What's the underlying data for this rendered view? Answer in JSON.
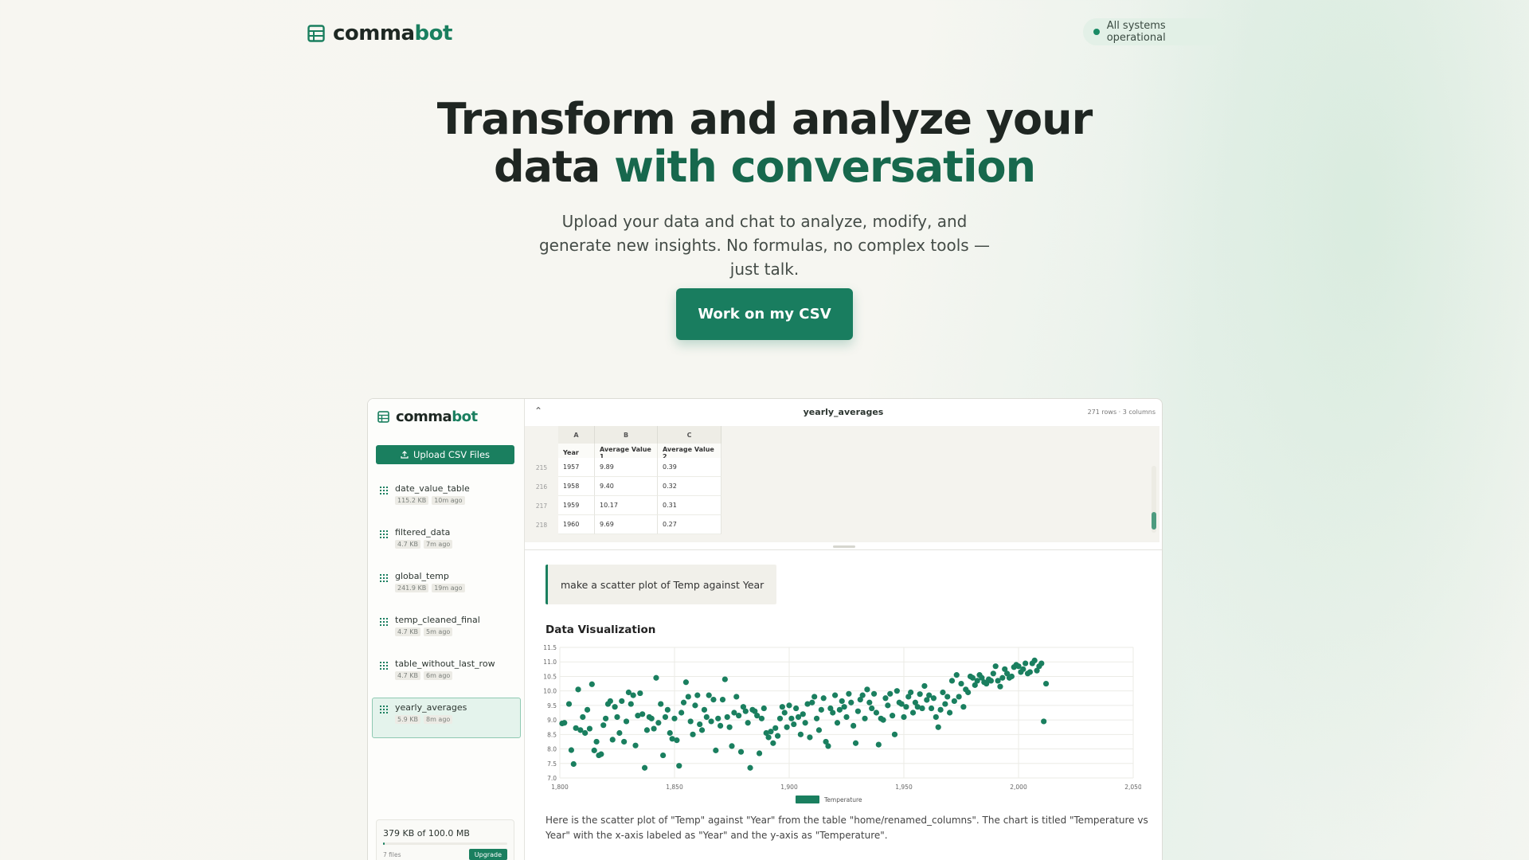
{
  "brand": {
    "name_part1": "comma",
    "name_part2": "bot"
  },
  "status": {
    "text": "All systems operational",
    "color": "#1a8a65"
  },
  "hero": {
    "title_line1": "Transform and analyze your",
    "title_line2_plain": "data ",
    "title_line2_accent": "with conversation",
    "subtitle": "Upload your data and chat to analyze, modify, and generate new insights. No formulas, no complex tools — just talk.",
    "cta_label": "Work on my CSV"
  },
  "sidebar": {
    "upload_label": "Upload CSV Files",
    "files": [
      {
        "name": "date_value_table",
        "size": "115.2 KB",
        "age": "10m ago",
        "active": false
      },
      {
        "name": "filtered_data",
        "size": "4.7 KB",
        "age": "7m ago",
        "active": false
      },
      {
        "name": "global_temp",
        "size": "241.9 KB",
        "age": "19m ago",
        "active": false
      },
      {
        "name": "temp_cleaned_final",
        "size": "4.7 KB",
        "age": "5m ago",
        "active": false
      },
      {
        "name": "table_without_last_row",
        "size": "4.7 KB",
        "age": "6m ago",
        "active": false
      },
      {
        "name": "yearly_averages",
        "size": "5.9 KB",
        "age": "8m ago",
        "active": true
      }
    ],
    "storage": {
      "text": "379 KB of 100.0 MB",
      "used_fraction": 0.0037,
      "files": "7 files",
      "upgrade_label": "Upgrade"
    }
  },
  "table": {
    "collapse_icon": "chevron-up-icon",
    "title": "yearly_averages",
    "meta": "271 rows · 3 columns",
    "column_letters": [
      "A",
      "B",
      "C"
    ],
    "headers": [
      "Year",
      "Average Value 1",
      "Average Value 2"
    ],
    "rows": [
      {
        "num": "215",
        "cells": [
          "1957",
          "9.89",
          "0.39"
        ]
      },
      {
        "num": "216",
        "cells": [
          "1958",
          "9.40",
          "0.32"
        ]
      },
      {
        "num": "217",
        "cells": [
          "1959",
          "10.17",
          "0.31"
        ]
      },
      {
        "num": "218",
        "cells": [
          "1960",
          "9.69",
          "0.27"
        ]
      }
    ]
  },
  "chat": {
    "user_message": "make a scatter plot of Temp against Year",
    "viz_title": "Data Visualization",
    "answer": "Here is the scatter plot of \"Temp\" against \"Year\" from the table \"home/renamed_columns\". The chart is titled \"Temperature vs Year\" with the x-axis labeled as \"Year\" and the y-axis as \"Temperature\"."
  },
  "chart_data": {
    "type": "scatter",
    "series": [
      {
        "name": "Temperature",
        "color": "#1a7f5f",
        "points": [
          [
            1801,
            8.88
          ],
          [
            1802,
            8.9
          ],
          [
            1804,
            9.55
          ],
          [
            1805,
            7.96
          ],
          [
            1806,
            7.48
          ],
          [
            1807,
            8.72
          ],
          [
            1808,
            10.05
          ],
          [
            1809,
            8.65
          ],
          [
            1810,
            9.1
          ],
          [
            1811,
            8.55
          ],
          [
            1812,
            9.35
          ],
          [
            1813,
            8.7
          ],
          [
            1814,
            10.23
          ],
          [
            1815,
            7.95
          ],
          [
            1816,
            8.25
          ],
          [
            1817,
            7.78
          ],
          [
            1818,
            7.82
          ],
          [
            1819,
            8.82
          ],
          [
            1820,
            9.05
          ],
          [
            1821,
            9.55
          ],
          [
            1822,
            9.65
          ],
          [
            1823,
            8.32
          ],
          [
            1824,
            9.45
          ],
          [
            1825,
            9.1
          ],
          [
            1826,
            8.55
          ],
          [
            1827,
            9.65
          ],
          [
            1828,
            8.25
          ],
          [
            1829,
            8.95
          ],
          [
            1830,
            9.95
          ],
          [
            1831,
            9.55
          ],
          [
            1832,
            9.85
          ],
          [
            1833,
            8.12
          ],
          [
            1834,
            9.15
          ],
          [
            1835,
            9.92
          ],
          [
            1836,
            9.2
          ],
          [
            1837,
            7.35
          ],
          [
            1838,
            8.65
          ],
          [
            1839,
            9.1
          ],
          [
            1840,
            9.05
          ],
          [
            1841,
            8.7
          ],
          [
            1842,
            10.45
          ],
          [
            1843,
            8.9
          ],
          [
            1844,
            9.55
          ],
          [
            1845,
            7.78
          ],
          [
            1846,
            9.1
          ],
          [
            1847,
            9.35
          ],
          [
            1848,
            8.55
          ],
          [
            1849,
            8.35
          ],
          [
            1850,
            9.05
          ],
          [
            1851,
            8.3
          ],
          [
            1852,
            7.42
          ],
          [
            1853,
            9.25
          ],
          [
            1854,
            9.6
          ],
          [
            1855,
            10.3
          ],
          [
            1856,
            9.8
          ],
          [
            1857,
            8.95
          ],
          [
            1858,
            8.5
          ],
          [
            1859,
            9.5
          ],
          [
            1860,
            9.85
          ],
          [
            1861,
            8.85
          ],
          [
            1862,
            8.65
          ],
          [
            1863,
            9.35
          ],
          [
            1864,
            9.1
          ],
          [
            1865,
            9.85
          ],
          [
            1866,
            8.95
          ],
          [
            1867,
            9.7
          ],
          [
            1868,
            7.95
          ],
          [
            1869,
            9.05
          ],
          [
            1870,
            8.8
          ],
          [
            1871,
            9.7
          ],
          [
            1872,
            10.4
          ],
          [
            1873,
            9.1
          ],
          [
            1874,
            8.75
          ],
          [
            1875,
            8.1
          ],
          [
            1876,
            9.25
          ],
          [
            1877,
            9.8
          ],
          [
            1878,
            9.15
          ],
          [
            1879,
            7.9
          ],
          [
            1880,
            9.45
          ],
          [
            1881,
            9.3
          ],
          [
            1882,
            8.9
          ],
          [
            1883,
            7.35
          ],
          [
            1884,
            9.35
          ],
          [
            1885,
            9.3
          ],
          [
            1886,
            9.15
          ],
          [
            1887,
            7.85
          ],
          [
            1888,
            9.05
          ],
          [
            1889,
            9.4
          ],
          [
            1890,
            8.55
          ],
          [
            1891,
            8.4
          ],
          [
            1892,
            8.6
          ],
          [
            1893,
            8.2
          ],
          [
            1894,
            8.72
          ],
          [
            1895,
            8.45
          ],
          [
            1896,
            9.05
          ],
          [
            1897,
            9.45
          ],
          [
            1898,
            9.25
          ],
          [
            1899,
            8.75
          ],
          [
            1900,
            9.5
          ],
          [
            1901,
            9.05
          ],
          [
            1902,
            8.85
          ],
          [
            1903,
            9.4
          ],
          [
            1904,
            9.1
          ],
          [
            1905,
            8.5
          ],
          [
            1906,
            9.2
          ],
          [
            1907,
            8.9
          ],
          [
            1908,
            9.55
          ],
          [
            1909,
            8.4
          ],
          [
            1910,
            9.6
          ],
          [
            1911,
            9.8
          ],
          [
            1912,
            9.05
          ],
          [
            1913,
            8.65
          ],
          [
            1914,
            9.35
          ],
          [
            1915,
            9.75
          ],
          [
            1916,
            8.25
          ],
          [
            1917,
            8.1
          ],
          [
            1918,
            9.4
          ],
          [
            1919,
            9.25
          ],
          [
            1920,
            9.85
          ],
          [
            1921,
            8.9
          ],
          [
            1922,
            9.35
          ],
          [
            1923,
            9.65
          ],
          [
            1924,
            9.45
          ],
          [
            1925,
            9.1
          ],
          [
            1926,
            9.9
          ],
          [
            1927,
            9.6
          ],
          [
            1928,
            8.8
          ],
          [
            1929,
            8.2
          ],
          [
            1930,
            9.3
          ],
          [
            1931,
            9.7
          ],
          [
            1932,
            9.85
          ],
          [
            1933,
            9.05
          ],
          [
            1934,
            10.05
          ],
          [
            1935,
            9.6
          ],
          [
            1936,
            9.4
          ],
          [
            1937,
            9.9
          ],
          [
            1938,
            9.25
          ],
          [
            1939,
            8.15
          ],
          [
            1940,
            9.05
          ],
          [
            1941,
            9.0
          ],
          [
            1942,
            9.75
          ],
          [
            1943,
            9.5
          ],
          [
            1944,
            9.9
          ],
          [
            1945,
            9.15
          ],
          [
            1946,
            8.5
          ],
          [
            1947,
            10.0
          ],
          [
            1948,
            9.6
          ],
          [
            1949,
            9.55
          ],
          [
            1950,
            9.1
          ],
          [
            1951,
            9.45
          ],
          [
            1952,
            9.8
          ],
          [
            1953,
            9.95
          ],
          [
            1954,
            9.25
          ],
          [
            1955,
            9.6
          ],
          [
            1956,
            9.45
          ],
          [
            1957,
            9.89
          ],
          [
            1958,
            9.4
          ],
          [
            1959,
            10.17
          ],
          [
            1960,
            9.69
          ],
          [
            1961,
            9.85
          ],
          [
            1962,
            9.4
          ],
          [
            1963,
            9.75
          ],
          [
            1964,
            9.1
          ],
          [
            1965,
            8.75
          ],
          [
            1966,
            9.35
          ],
          [
            1967,
            9.95
          ],
          [
            1968,
            9.55
          ],
          [
            1969,
            9.8
          ],
          [
            1970,
            9.25
          ],
          [
            1971,
            10.35
          ],
          [
            1972,
            9.65
          ],
          [
            1973,
            10.55
          ],
          [
            1974,
            9.8
          ],
          [
            1975,
            10.25
          ],
          [
            1976,
            9.45
          ],
          [
            1977,
            10.05
          ],
          [
            1978,
            9.95
          ],
          [
            1979,
            10.5
          ],
          [
            1980,
            10.45
          ],
          [
            1981,
            10.2
          ],
          [
            1982,
            10.35
          ],
          [
            1983,
            10.55
          ],
          [
            1984,
            10.45
          ],
          [
            1985,
            10.3
          ],
          [
            1986,
            10.25
          ],
          [
            1987,
            10.4
          ],
          [
            1988,
            10.35
          ],
          [
            1989,
            10.6
          ],
          [
            1990,
            10.85
          ],
          [
            1991,
            10.35
          ],
          [
            1992,
            10.15
          ],
          [
            1993,
            10.45
          ],
          [
            1994,
            10.75
          ],
          [
            1995,
            10.6
          ],
          [
            1996,
            10.45
          ],
          [
            1997,
            10.5
          ],
          [
            1998,
            10.82
          ],
          [
            1999,
            10.9
          ],
          [
            2000,
            10.85
          ],
          [
            2001,
            10.65
          ],
          [
            2002,
            10.75
          ],
          [
            2003,
            10.95
          ],
          [
            2004,
            10.6
          ],
          [
            2005,
            10.65
          ],
          [
            2006,
            10.95
          ],
          [
            2007,
            11.05
          ],
          [
            2008,
            10.7
          ],
          [
            2009,
            10.85
          ],
          [
            2010,
            10.95
          ],
          [
            2011,
            8.95
          ],
          [
            2012,
            10.25
          ]
        ]
      }
    ],
    "xlim": [
      1800,
      2050
    ],
    "ylim": [
      7.0,
      11.5
    ],
    "x_ticks": [
      "1,800",
      "1,850",
      "1,900",
      "1,950",
      "2,000",
      "2,050"
    ],
    "y_ticks": [
      "7.0",
      "7.5",
      "8.0",
      "8.5",
      "9.0",
      "9.5",
      "10.0",
      "10.5",
      "11.0",
      "11.5"
    ],
    "x_tick_values": [
      1800,
      1850,
      1900,
      1950,
      2000,
      2050
    ],
    "y_tick_values": [
      7.0,
      7.5,
      8.0,
      8.5,
      9.0,
      9.5,
      10.0,
      10.5,
      11.0,
      11.5
    ],
    "legend_position": "bottom",
    "grid": true
  },
  "colors": {
    "accent": "#1a7f5f",
    "accent_dark": "#17684d"
  }
}
